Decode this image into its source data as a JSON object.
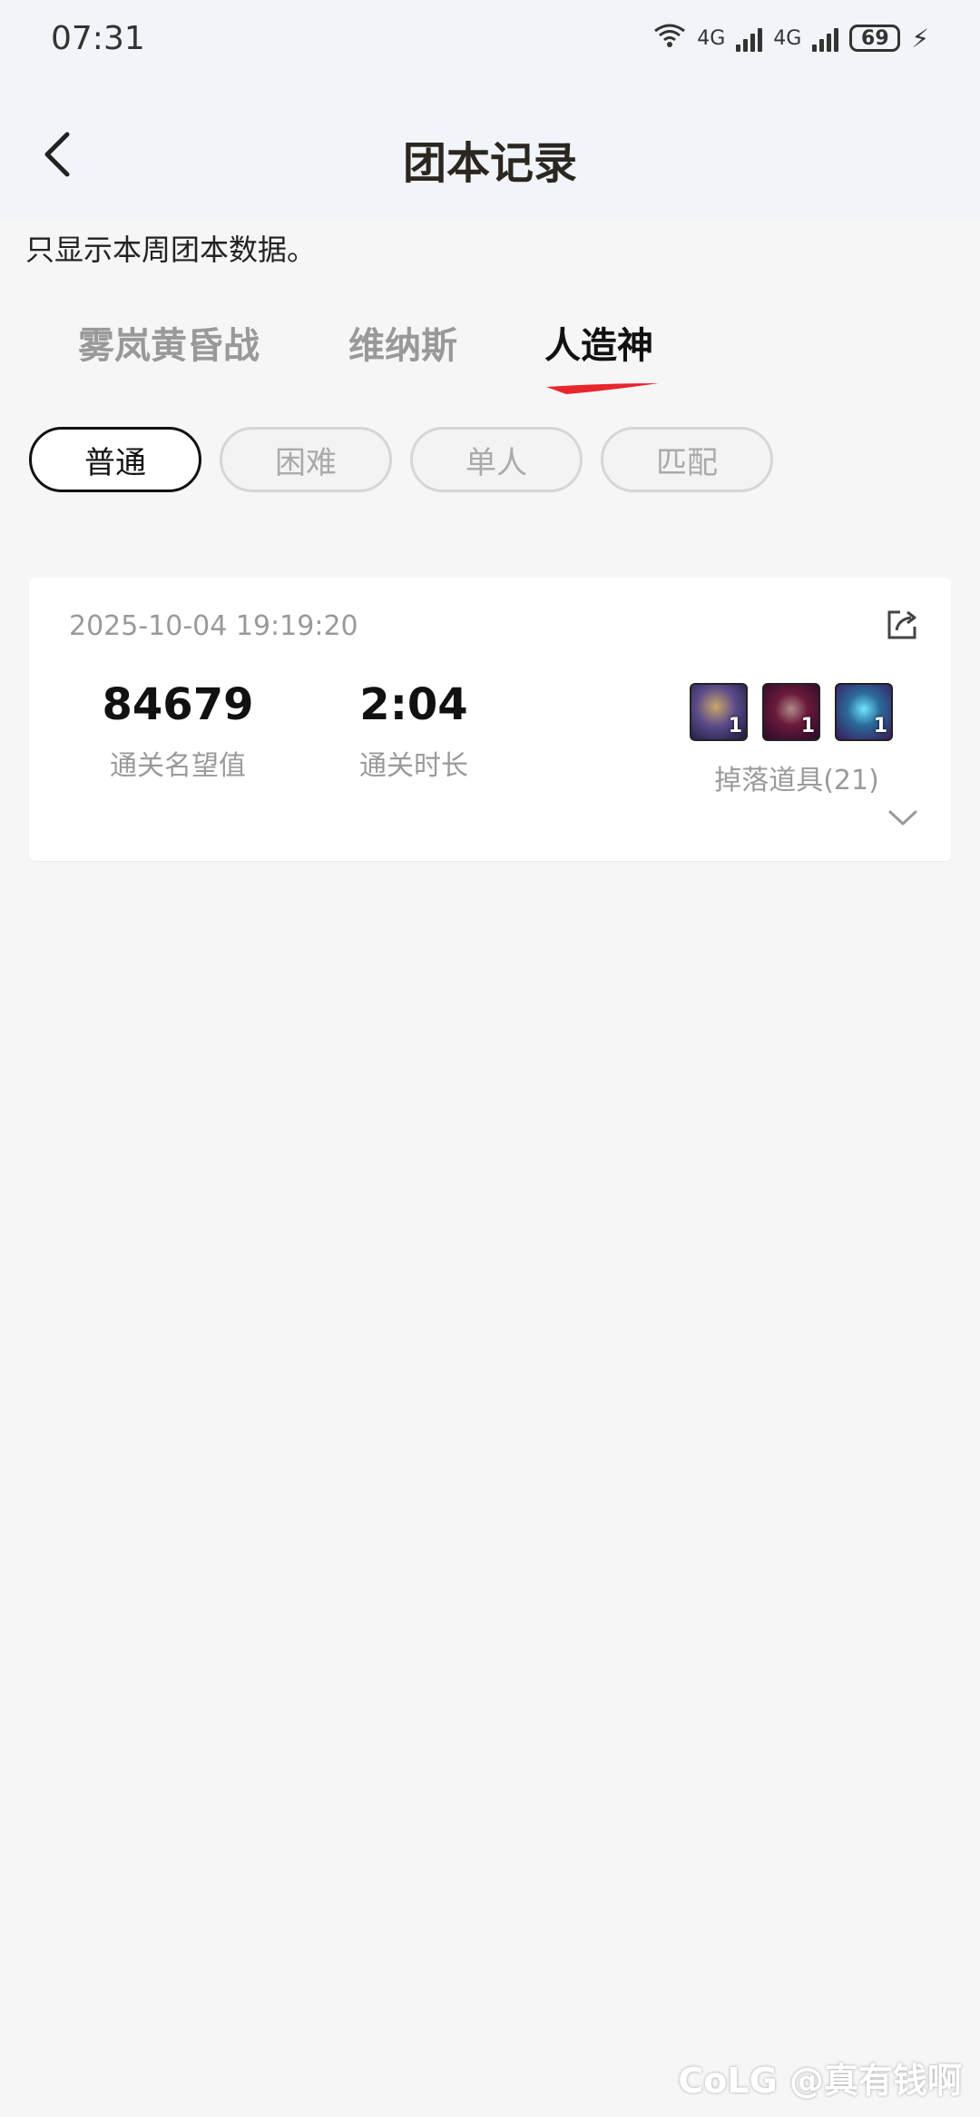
{
  "status_bar": {
    "time": "07:31",
    "network_1": "4G",
    "network_2": "4G",
    "wifi_label": "6",
    "battery": "69"
  },
  "header": {
    "title": "团本记录",
    "back_icon": "chevron-left-icon"
  },
  "notice": "只显示本周团本数据。",
  "tabs": [
    {
      "label": "雾岚黄昏战",
      "active": false
    },
    {
      "label": "维纳斯",
      "active": false
    },
    {
      "label": "人造神",
      "active": true
    }
  ],
  "accent_color": "#e8262c",
  "chips": [
    {
      "label": "普通",
      "active": true
    },
    {
      "label": "困难",
      "active": false
    },
    {
      "label": "单人",
      "active": false
    },
    {
      "label": "匹配",
      "active": false
    }
  ],
  "record": {
    "datetime": "2025-10-04 19:19:20",
    "reputation_value": "84679",
    "reputation_label": "通关名望值",
    "duration_value": "2:04",
    "duration_label": "通关时长",
    "drops_label": "掉落道具(21)",
    "drop_items": [
      {
        "icon": "helmet-item-icon",
        "qty": "1"
      },
      {
        "icon": "armor-item-icon",
        "qty": "1"
      },
      {
        "icon": "crystal-armor-item-icon",
        "qty": "1"
      }
    ]
  },
  "watermark": "CoLG @真有钱啊"
}
